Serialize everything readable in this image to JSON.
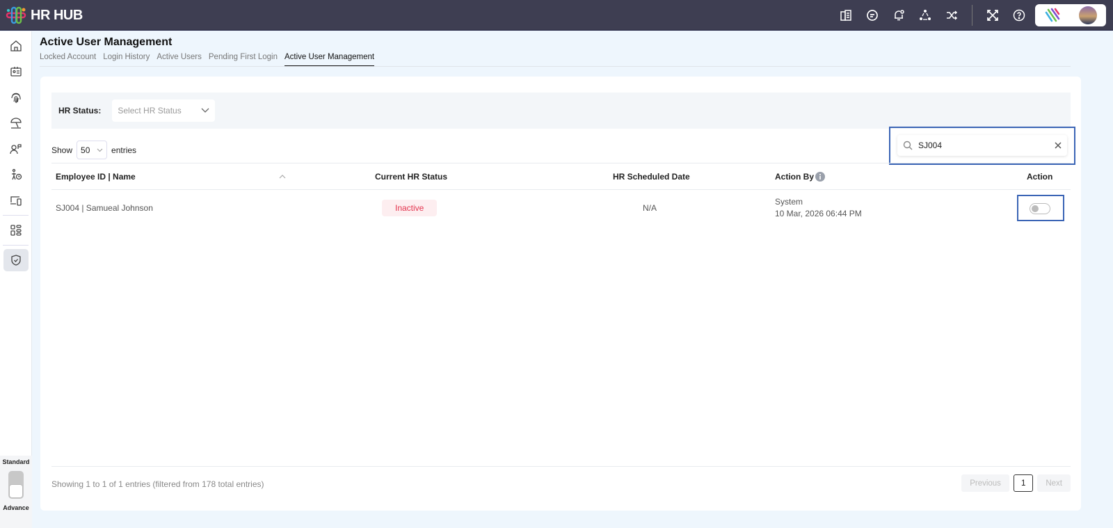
{
  "app": {
    "title": "HR HUB"
  },
  "topbar": {
    "icons": [
      "directory-icon",
      "chat-icon",
      "notification-bell-icon",
      "network-icon",
      "shuffle-icon",
      "fullscreen-icon",
      "help-icon"
    ]
  },
  "sidebar": {
    "items": [
      "home",
      "id-card",
      "fingerprint",
      "leave-umbrella",
      "user-flag",
      "person-clock",
      "devices",
      "apps-grid",
      "shield-check"
    ],
    "active": "shield-check"
  },
  "mode": {
    "top": "Standard",
    "bottom": "Advance"
  },
  "page": {
    "title": "Active User Management",
    "tabs": [
      {
        "label": "Locked Account"
      },
      {
        "label": "Login History"
      },
      {
        "label": "Active Users"
      },
      {
        "label": "Pending First Login"
      },
      {
        "label": "Active User Management",
        "active": true
      }
    ]
  },
  "filter": {
    "label": "HR Status:",
    "placeholder": "Select HR Status"
  },
  "entries": {
    "show": "Show",
    "value": "50",
    "suffix": "entries"
  },
  "search": {
    "value": "SJ004"
  },
  "table": {
    "columns": [
      "Employee ID | Name",
      "Current HR Status",
      "HR Scheduled Date",
      "Action By",
      "Action"
    ],
    "rows": [
      {
        "employee": "SJ004 | Samueal Johnson",
        "status": "Inactive",
        "scheduled": "N/A",
        "action_by": "System",
        "action_date": "10 Mar, 2026 06:44 PM",
        "toggle_on": false
      }
    ]
  },
  "footer": {
    "info": "Showing 1 to 1 of 1 entries (filtered from 178 total entries)",
    "previous": "Previous",
    "page": "1",
    "next": "Next"
  },
  "colors": {
    "topbar": "#3e3e52",
    "inactive": "#e3344e",
    "highlight": "#3a64b5"
  }
}
